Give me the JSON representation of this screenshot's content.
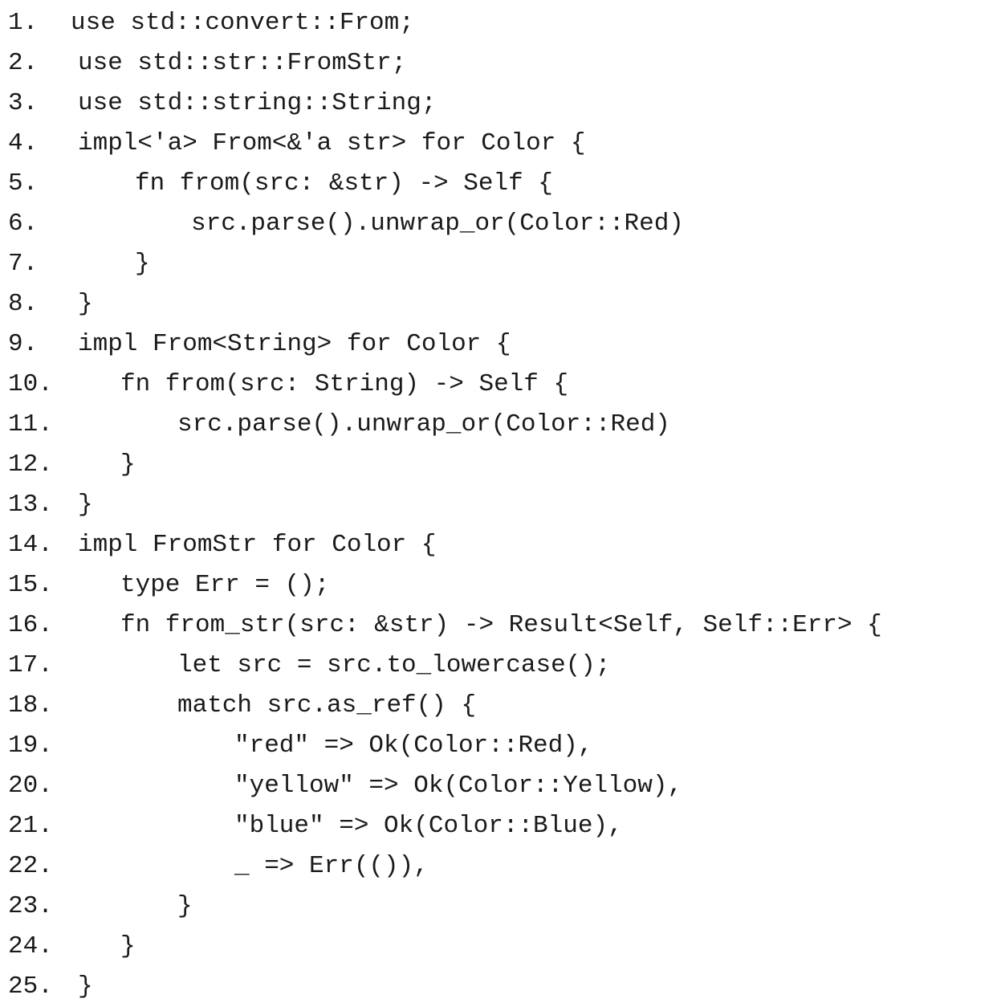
{
  "code_listing": {
    "lines": [
      {
        "number": "1.",
        "code": "use std::convert::From;"
      },
      {
        "number": "2.",
        "code": "use std::str::FromStr;"
      },
      {
        "number": "3.",
        "code": "use std::string::String;"
      },
      {
        "number": "4.",
        "code": "impl<'a> From<&'a str> for Color {"
      },
      {
        "number": "5.",
        "code": "fn from(src: &str) -> Self {"
      },
      {
        "number": "6.",
        "code": "src.parse().unwrap_or(Color::Red)"
      },
      {
        "number": "7.",
        "code": "}"
      },
      {
        "number": "8.",
        "code": "}"
      },
      {
        "number": "9.",
        "code": "impl From<String> for Color {"
      },
      {
        "number": "10.",
        "code": "fn from(src: String) -> Self {"
      },
      {
        "number": "11.",
        "code": "src.parse().unwrap_or(Color::Red)"
      },
      {
        "number": "12.",
        "code": "}"
      },
      {
        "number": "13.",
        "code": "}"
      },
      {
        "number": "14.",
        "code": "impl FromStr for Color {"
      },
      {
        "number": "15.",
        "code": "type Err = ();"
      },
      {
        "number": "16.",
        "code": "fn from_str(src: &str) -> Result<Self, Self::Err> {"
      },
      {
        "number": "17.",
        "code": "let src = src.to_lowercase();"
      },
      {
        "number": "18.",
        "code": "match src.as_ref() {"
      },
      {
        "number": "19.",
        "code": "\"red\" => Ok(Color::Red),"
      },
      {
        "number": "20.",
        "code": "\"yellow\" => Ok(Color::Yellow),"
      },
      {
        "number": "21.",
        "code": "\"blue\" => Ok(Color::Blue),"
      },
      {
        "number": "22.",
        "code": "_ => Err(()),"
      },
      {
        "number": "23.",
        "code": "}"
      },
      {
        "number": "24.",
        "code": "}"
      },
      {
        "number": "25.",
        "code": "}"
      }
    ]
  }
}
